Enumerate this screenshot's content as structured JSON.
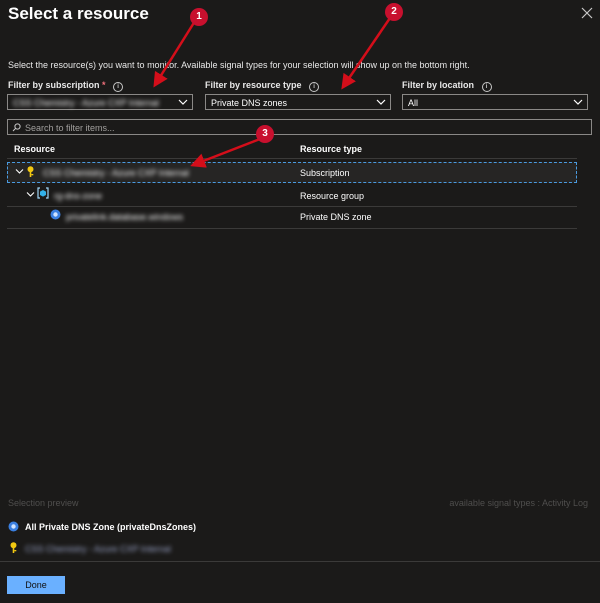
{
  "dialog": {
    "title": "Select a resource",
    "description": "Select the resource(s) you want to monitor. Available signal types for your selection will show up on the bottom right."
  },
  "filters": {
    "subscription": {
      "label": "Filter by subscription",
      "required_mark": "*",
      "value": "CSS Chemistry - Azure CXP Internal"
    },
    "resource_type": {
      "label": "Filter by resource type",
      "value": "Private DNS zones"
    },
    "location": {
      "label": "Filter by location",
      "value": "All"
    }
  },
  "search": {
    "placeholder": "Search to filter items..."
  },
  "table": {
    "headers": {
      "resource": "Resource",
      "resource_type": "Resource type"
    },
    "rows": [
      {
        "name": "CSS Chemistry - Azure CXP Internal",
        "type": "Subscription",
        "icon": "key-icon"
      },
      {
        "name": "rg-dns-zone",
        "type": "Resource group",
        "icon": "resource-group-icon"
      },
      {
        "name": "privatelink.database.windows",
        "type": "Private DNS zone",
        "icon": "dns-zone-icon"
      }
    ]
  },
  "preview": {
    "label": "Selection preview",
    "signal_types": "available signal types : Activity Log",
    "selected_zone": "All Private DNS Zone (privateDnsZones)",
    "selected_subscription": "CSS Chemistry - Azure CXP Internal"
  },
  "annotations": [
    "1",
    "2",
    "3"
  ],
  "footer": {
    "done_label": "Done"
  },
  "colors": {
    "background": "#1b1a19",
    "accent": "#6ab0ff",
    "annotation": "#c8102e",
    "selection_border": "#4a9be0"
  }
}
